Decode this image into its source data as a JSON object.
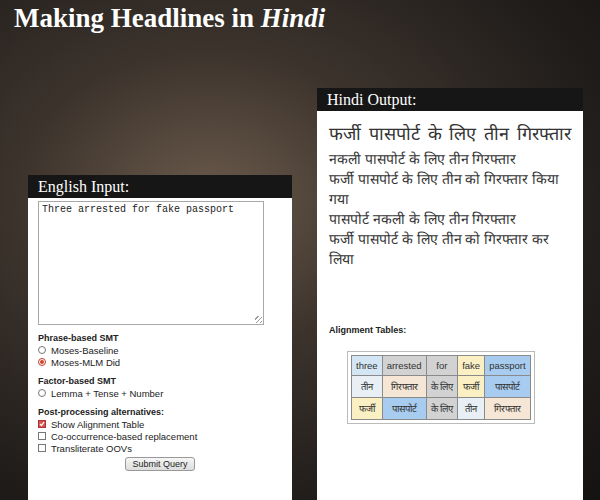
{
  "title": {
    "main": "Making Headlines in ",
    "emphasis": "Hindi"
  },
  "input_panel": {
    "heading": "English Input:",
    "text": "Three arrested for fake passport",
    "groups": [
      {
        "label": "Phrase-based SMT",
        "options": [
          {
            "kind": "radio",
            "label": "Moses-Baseline",
            "selected": false
          },
          {
            "kind": "radio",
            "label": "Moses-MLM Did",
            "selected": true
          }
        ]
      },
      {
        "label": "Factor-based SMT",
        "options": [
          {
            "kind": "radio",
            "label": "Lemma + Tense + Number",
            "selected": false
          }
        ]
      },
      {
        "label": "Post-processing alternatives:",
        "options": [
          {
            "kind": "checkbox",
            "label": "Show Alignment Table",
            "checked": true
          },
          {
            "kind": "checkbox",
            "label": "Co-occurrence-based replacement",
            "checked": false
          },
          {
            "kind": "checkbox",
            "label": "Transliterate OOVs",
            "checked": false
          }
        ]
      }
    ],
    "button": "Submit Query"
  },
  "output_panel": {
    "heading": "Hindi Output:",
    "outputs": [
      "फर्जी पासपोर्ट के लिए तीन गिरफ्तार",
      "नकली पासपोर्ट के लिए तीन गिरफ्तार",
      "फर्जी पासपोर्ट के लिए तीन को गिरफ्तार किया गया",
      "पासपोर्ट नकली के लिए तीन गिरफ्तार",
      "फर्जी पासपोर्ट के लिए तीन को गिरफ्तार कर लिया"
    ],
    "alignment_label": "Alignment Tables:",
    "alignment": {
      "header": [
        {
          "text": "three",
          "color": "#d4e6f4"
        },
        {
          "text": "arrested",
          "color": "#d2d2d2"
        },
        {
          "text": "for",
          "color": "#d2d2d2"
        },
        {
          "text": "fake",
          "color": "#fbf0c4"
        },
        {
          "text": "passport",
          "color": "#a8ccef"
        }
      ],
      "rows": [
        [
          {
            "text": "तीन",
            "color": "#e8f0f6"
          },
          {
            "text": "गिरफ्तार",
            "color": "#f6e6d6"
          },
          {
            "text": "के लिए",
            "color": "#d2d2d2"
          },
          {
            "text": "फर्जी",
            "color": "#fbf0c4"
          },
          {
            "text": "पासपोर्ट",
            "color": "#a8ccef"
          }
        ],
        [
          {
            "text": "फर्जी",
            "color": "#fbf0c4"
          },
          {
            "text": "पासपोर्ट",
            "color": "#a8ccef"
          },
          {
            "text": "के लिए",
            "color": "#d2d2d2"
          },
          {
            "text": "तीन",
            "color": "#e8f0f6"
          },
          {
            "text": "गिरफ्तार",
            "color": "#f6e6d6"
          }
        ]
      ]
    }
  }
}
